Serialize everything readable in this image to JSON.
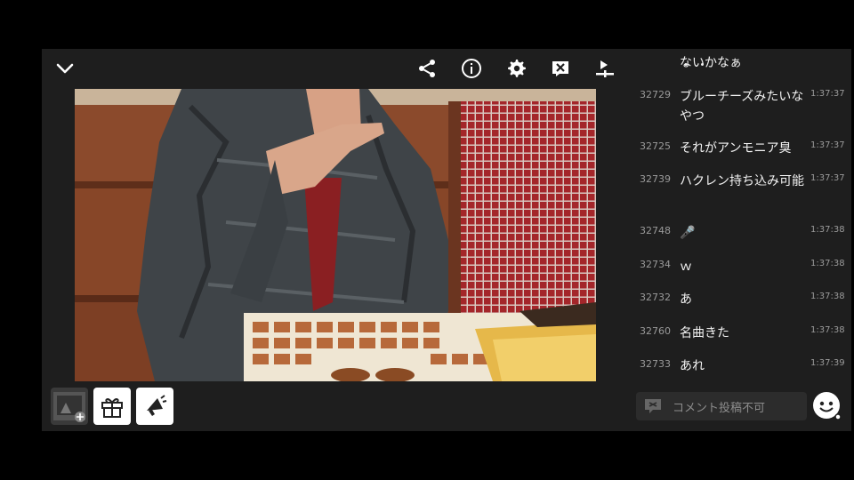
{
  "toolbar": {
    "icons": [
      "chevron-down-icon",
      "share-icon",
      "info-icon",
      "gear-icon",
      "close-box-icon",
      "playback-speed-icon"
    ]
  },
  "bottombar": {
    "buttons": [
      "add-scene-button",
      "gift-button",
      "announce-button"
    ]
  },
  "chat": {
    "partial_top": "ないかなぁ",
    "messages": [
      {
        "num": "32729",
        "text": "ブルーチーズみたいなやつ",
        "time": "1:37:37"
      },
      {
        "num": "32725",
        "text": "それがアンモニア臭",
        "time": "1:37:37"
      },
      {
        "num": "32739",
        "text": "ハクレン持ち込み可能",
        "time": "1:37:37"
      },
      {
        "num": "32748",
        "text": "🎤",
        "time": "1:37:38"
      },
      {
        "num": "32734",
        "text": "ｗ",
        "time": "1:37:38"
      },
      {
        "num": "32732",
        "text": "あ",
        "time": "1:37:38"
      },
      {
        "num": "32760",
        "text": "名曲きた",
        "time": "1:37:38"
      },
      {
        "num": "32733",
        "text": "あれ",
        "time": "1:37:39"
      }
    ],
    "comment_placeholder": "コメント投稿不可"
  },
  "colors": {
    "background": "#1e1e1e",
    "chat_text": "#f2f2f2",
    "meta_text": "#9a9a9a",
    "handle_accent": "#d88a2a"
  }
}
